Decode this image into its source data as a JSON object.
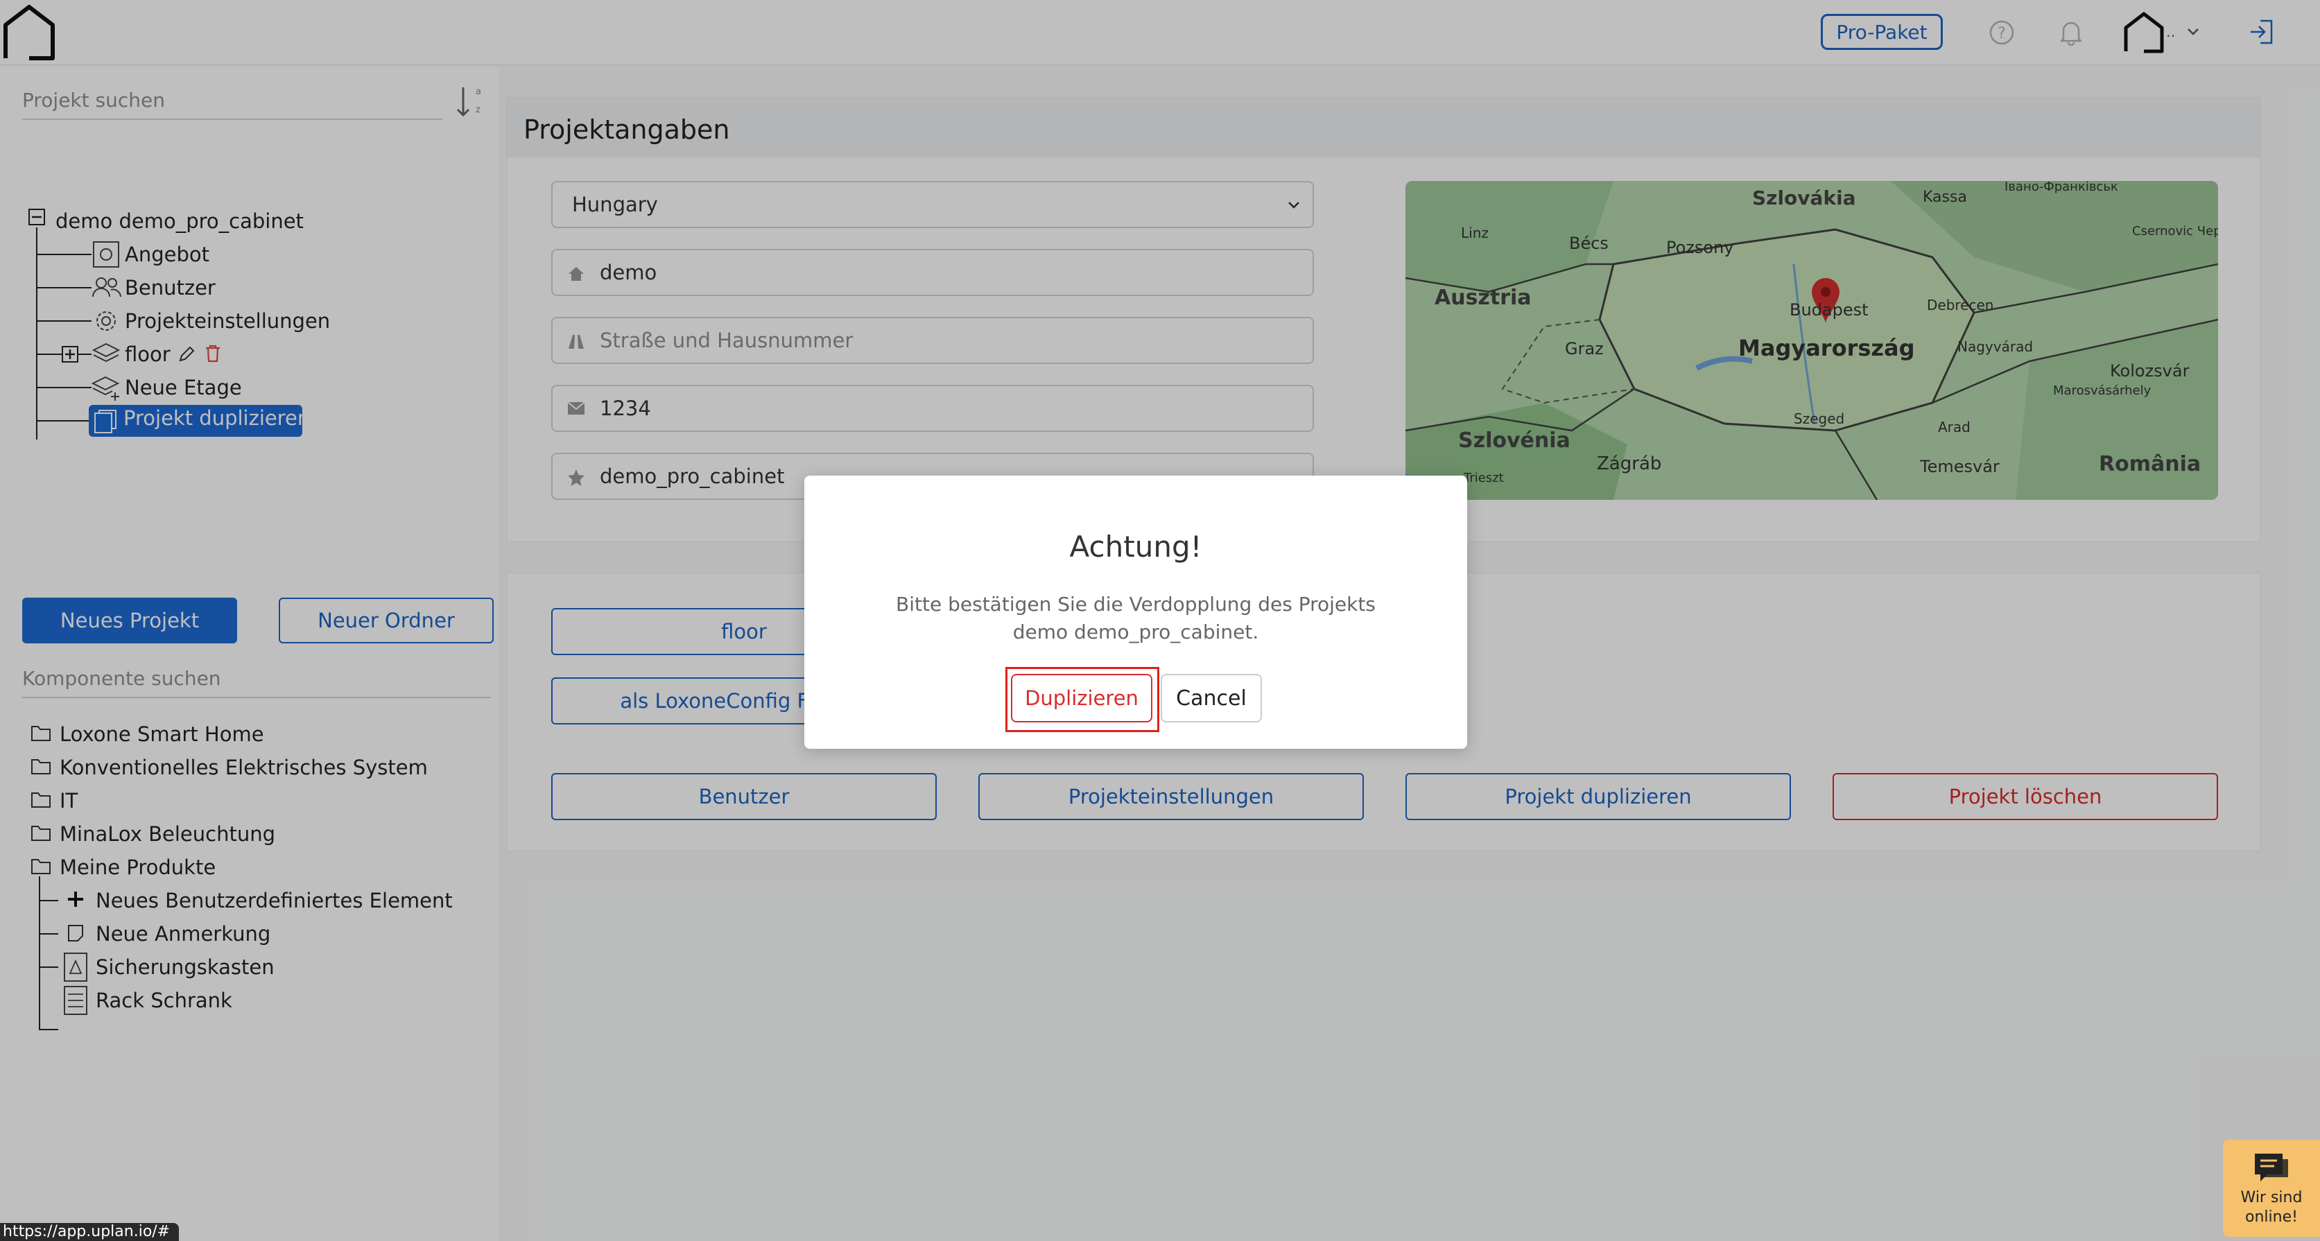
{
  "header": {
    "pro_label": "Pro-Paket",
    "user_chevron": "‥"
  },
  "sidebar": {
    "project_search_placeholder": "Projekt suchen",
    "sort_label_a": "a",
    "sort_label_z": "z",
    "project_tree": {
      "root": "demo demo_pro_cabinet",
      "items": [
        "Angebot",
        "Benutzer",
        "Projekteinstellungen",
        "floor",
        "Neue Etage",
        "Projekt duplizieren"
      ]
    },
    "new_project_label": "Neues Projekt",
    "new_folder_label": "Neuer Ordner",
    "component_search_placeholder": "Komponente suchen",
    "component_folders": [
      "Loxone Smart Home",
      "Konventionelles Elektrisches System",
      "IT",
      "MinaLox Beleuchtung",
      "Meine Produkte"
    ],
    "my_products": [
      "Neues Benutzerdefiniertes Element",
      "Neue Anmerkung",
      "Sicherungskasten",
      "Rack Schrank"
    ]
  },
  "main": {
    "section_title": "Projektangaben",
    "country_value": "Hungary",
    "name_value": "demo",
    "street_placeholder": "Straße und Hausnummer",
    "zip_value": "1234",
    "project_id_value": "demo_pro_cabinet",
    "map_labels": {
      "slovakia": "Szlovákia",
      "kassa": "Kassa",
      "ivano": "Івано-Франківськ",
      "linz": "Linz",
      "becs": "Bécs",
      "pozsony": "Pozsony",
      "csernovic": "Csernovic Чернівці",
      "austria": "Ausztria",
      "budapest": "Budapest",
      "debrecen": "Debrecen",
      "graz": "Graz",
      "hungary": "Magyarország",
      "nagyvarad": "Nagyvárad",
      "kolozsvar": "Kolozsvár",
      "marosvasarhely": "Marosvásárhely",
      "szeged": "Szeged",
      "arad": "Arad",
      "slovenia": "Szlovénia",
      "trieszt": "Trieszt",
      "zagrab": "Zágráb",
      "temesvar": "Temesvár",
      "romania": "România"
    },
    "floor_button": "floor",
    "loxone_button": "als LoxoneConfig Format",
    "bottom_buttons": [
      "Benutzer",
      "Projekteinstellungen",
      "Projekt duplizieren",
      "Projekt löschen"
    ]
  },
  "modal": {
    "title": "Achtung!",
    "body": "Bitte bestätigen Sie die Verdopplung des Projekts demo demo_pro_cabinet.",
    "confirm_label": "Duplizieren",
    "cancel_label": "Cancel"
  },
  "status_bar": {
    "url": "https://app.uplan.io/#"
  },
  "chat": {
    "line1": "Wir sind",
    "line2": "online!"
  },
  "colors": {
    "accent": "#1f6ad4",
    "danger": "#d92c2c",
    "chat_bg": "#f5c16c"
  }
}
